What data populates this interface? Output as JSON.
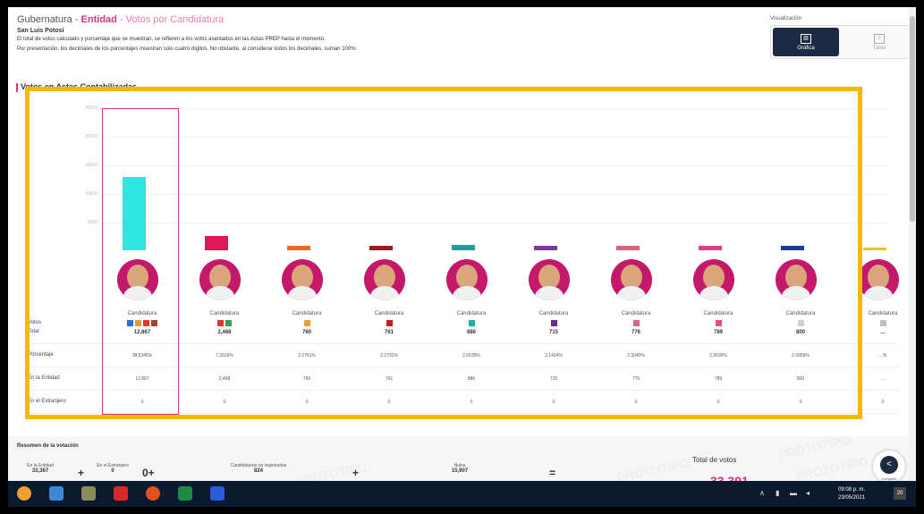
{
  "header": {
    "title_prefix": "Gubernatura - ",
    "title_entity": "Entidad",
    "title_suffix": " - Votos por Candidatura",
    "subtitle": "San Luis Potosí",
    "desc_line1": "El total de votos calculado y porcentaje que se muestran, se refieren a los votos asentados en las Actas PREP hasta el momento.",
    "desc_line2": "Por presentación, los decimales de los porcentajes muestran solo cuatro dígitos. No obstante, al considerar todos los decimales, suman 100%."
  },
  "visualization": {
    "label": "Visualización",
    "active_label": "Gráfica",
    "inactive_label": "Tabla"
  },
  "section_title": "Votos en Actas Contabilizadas",
  "y_ticks": [
    "25000",
    "20000",
    "15000",
    "10000",
    "5000"
  ],
  "row_labels": {
    "votes": "Votos",
    "votes2": "Total",
    "percentage": "Porcentaje",
    "in_entity": "En la Entidad",
    "abroad": "En el Extranjero"
  },
  "candidates": [
    {
      "label": "Candidatura",
      "votes": "12,867",
      "percentage": "38.5345%",
      "entity": "12,867",
      "abroad": "0",
      "color": "#2ee6e0",
      "fraction": 0.5147,
      "logos": [
        "#2a6fd6",
        "#e0a030",
        "#e03a2a",
        "#9c4a2a"
      ]
    },
    {
      "label": "Candidatura",
      "votes": "2,468",
      "percentage": "7.3915%",
      "entity": "2,468",
      "abroad": "0",
      "color": "#e0185a",
      "fraction": 0.0987,
      "logos": [
        "#e03a2a",
        "#3aa050"
      ]
    },
    {
      "label": "Candidatura",
      "votes": "760",
      "percentage": "2.2761%",
      "entity": "760",
      "abroad": "0",
      "color": "#e86a1a",
      "fraction": 0.0304,
      "logos": [
        "#f0a030"
      ]
    },
    {
      "label": "Candidatura",
      "votes": "761",
      "percentage": "2.2791%",
      "entity": "761",
      "abroad": "0",
      "color": "#a01a1a",
      "fraction": 0.0304,
      "logos": [
        "#c02020"
      ]
    },
    {
      "label": "Candidatura",
      "votes": "886",
      "percentage": "2.6535%",
      "entity": "886",
      "abroad": "0",
      "color": "#1aa0a0",
      "fraction": 0.0354,
      "logos": [
        "#20b0a0"
      ]
    },
    {
      "label": "Candidatura",
      "votes": "715",
      "percentage": "2.1414%",
      "entity": "715",
      "abroad": "0",
      "color": "#7a3aa0",
      "fraction": 0.0286,
      "logos": [
        "#6a2a90"
      ]
    },
    {
      "label": "Candidatura",
      "votes": "776",
      "percentage": "2.3240%",
      "entity": "776",
      "abroad": "0",
      "color": "#e0607a",
      "fraction": 0.031,
      "logos": [
        "#e0609a"
      ]
    },
    {
      "label": "Candidatura",
      "votes": "789",
      "percentage": "2.3630%",
      "entity": "789",
      "abroad": "0",
      "color": "#e03a8a",
      "fraction": 0.0316,
      "logos": [
        "#e84a8a"
      ]
    },
    {
      "label": "Candidatura",
      "votes": "800",
      "percentage": "2.3959%",
      "entity": "800",
      "abroad": "0",
      "color": "#1a3aa0",
      "fraction": 0.032,
      "logos": [
        "#d0d0d0"
      ]
    },
    {
      "label": "Candidatura",
      "votes": "...",
      "percentage": "...%",
      "entity": "...",
      "abroad": "0",
      "color": "#f0c020",
      "fraction": 0.02,
      "logos": [
        "#c0c0c0"
      ]
    }
  ],
  "summary": {
    "title": "Resumen de la votación",
    "in_entity_label": "En la Entidad",
    "in_entity_value": "33,367",
    "abroad_label": "En el Extranjero",
    "abroad_value": "0",
    "unregistered_label": "Candidaturas no registradas",
    "unregistered_value": "824",
    "null_label": "Nulos",
    "null_value": "15,907",
    "total_label": "Total de votos",
    "total_value": "33,391",
    "share_label": "Compartir",
    "watermarks": [
      "PROTOTIPO",
      "PROTOTIPO",
      "PROTOTIPO",
      "PROTOTIPO"
    ]
  },
  "taskbar": {
    "time": "09:08 p. m.",
    "date": "23/05/2021",
    "notif": "20",
    "icons": [
      "windows-icon",
      "people-icon",
      "folder-icon",
      "pdf-icon",
      "chrome-icon",
      "excel-icon",
      "word-icon"
    ]
  }
}
